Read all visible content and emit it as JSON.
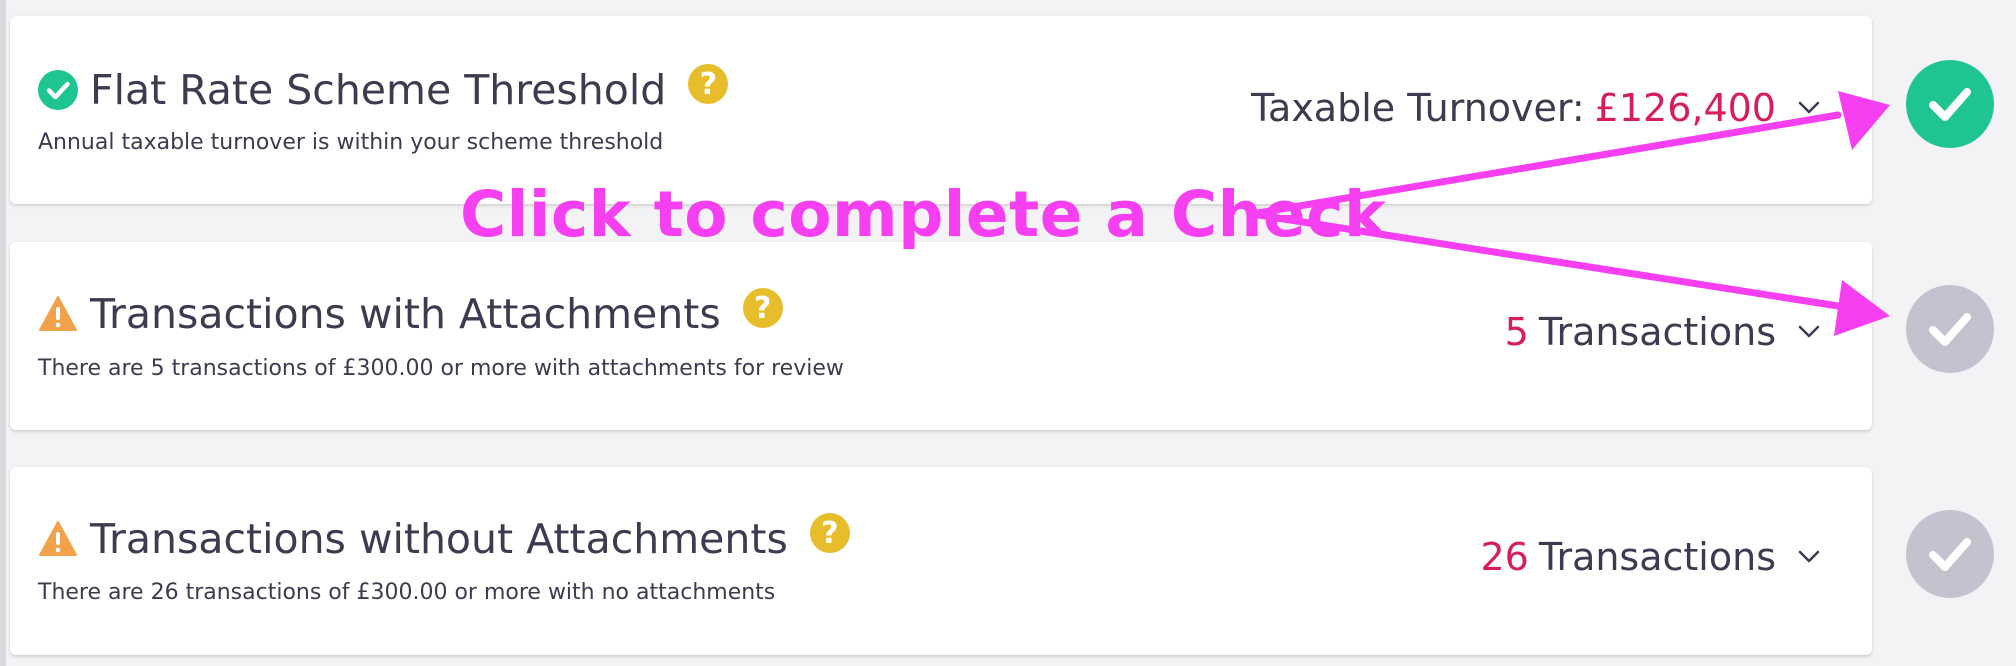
{
  "colors": {
    "accent": "#d81d5e",
    "success": "#1fc591",
    "pending": "#c6c1ce",
    "warning": "#f2a24a",
    "help": "#e8bd2c",
    "annotation": "#f53ff0"
  },
  "checks": [
    {
      "title": "Flat Rate Scheme Threshold",
      "description": "Annual taxable turnover is within your scheme threshold",
      "value_label": "Taxable Turnover:",
      "value_amount": "£126,400",
      "status_icon": "check-circle-icon",
      "help_symbol": "?",
      "complete": true
    },
    {
      "title": "Transactions with Attachments",
      "description": "There are 5 transactions of £300.00 or more with attachments for review",
      "value_count": "5",
      "value_label": "Transactions",
      "status_icon": "warning-triangle-icon",
      "help_symbol": "?",
      "complete": false
    },
    {
      "title": "Transactions without Attachments",
      "description": "There are 26 transactions of £300.00 or more with no attachments",
      "value_count": "26",
      "value_label": "Transactions",
      "status_icon": "warning-triangle-icon",
      "help_symbol": "?",
      "complete": false
    }
  ],
  "annotation": {
    "text": "Click to complete a Check"
  }
}
